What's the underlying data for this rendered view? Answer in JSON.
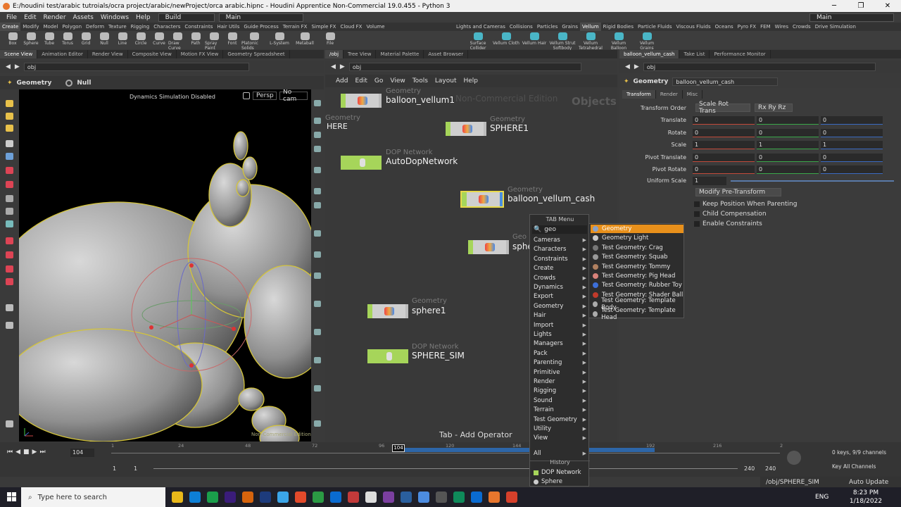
{
  "window": {
    "title": "E:/houdini test/arabic tutroials/ocra project/arabic/newProject/orca arabic.hipnc - Houdini Apprentice Non-Commercial 19.0.455 - Python 3",
    "controls": [
      "─",
      "❐",
      "✕"
    ]
  },
  "menubar": {
    "items": [
      "File",
      "Edit",
      "Render",
      "Assets",
      "Windows",
      "Help"
    ],
    "desktop_build": "Build",
    "desktop_main": "Main",
    "desktop_right": "Main"
  },
  "shelf": {
    "tabs_left": [
      "Create",
      "Modify",
      "Model",
      "Polygon",
      "Deform",
      "Texture",
      "Rigging",
      "Characters",
      "Constraints",
      "Hair Utils",
      "Guide Process",
      "Terrain FX",
      "Simple FX",
      "Cloud FX",
      "Volume"
    ],
    "tabs_right": [
      "Lights and Cameras",
      "Collisions",
      "Particles",
      "Grains",
      "Vellum",
      "Rigid Bodies",
      "Particle Fluids",
      "Viscous Fluids",
      "Oceans",
      "Pyro FX",
      "FEM",
      "Wires",
      "Crowds",
      "Drive Simulation"
    ],
    "tools_left": [
      "Box",
      "Sphere",
      "Tube",
      "Torus",
      "Grid",
      "Null",
      "Line",
      "Circle",
      "Curve",
      "Draw Curve",
      "Path",
      "Spray Paint",
      "Font",
      "Platonic Solids",
      "L-System",
      "Metaball",
      "File"
    ],
    "tools_right": [
      "Surface Collider",
      "Vellum Cloth",
      "Vellum Hair",
      "Vellum Strut Softbody",
      "Vellum Tetrahedral",
      "Vellum Balloon",
      "Vellum Grains"
    ]
  },
  "viewer": {
    "tabs": [
      "Scene View",
      "Animation Editor",
      "Render View",
      "Composite View",
      "Motion FX View",
      "Geometry Spreadsheet"
    ],
    "path": "obj",
    "context": "Geometry",
    "null_label": "Null",
    "status": "Dynamics Simulation Disabled",
    "persp": "Persp",
    "cam": "No cam",
    "watermark": "Non-Commercial Edition"
  },
  "network": {
    "tabs": [
      "/obj",
      "Tree View",
      "Material Palette",
      "Asset Browser"
    ],
    "path": "obj",
    "menus": [
      "Add",
      "Edit",
      "Go",
      "View",
      "Tools",
      "Layout",
      "Help"
    ],
    "watermark": "Non-Commercial Edition",
    "context_label": "Objects",
    "hint": "Tab - Add Operator",
    "nodes": [
      {
        "type": "Geometry",
        "name": "balloon_vellum1"
      },
      {
        "type": "Geometry",
        "name": "HERE"
      },
      {
        "type": "Geometry",
        "name": "SPHERE1"
      },
      {
        "type": "DOP Network",
        "name": "AutoDopNetwork"
      },
      {
        "type": "Geometry",
        "name": "balloon_vellum_cash"
      },
      {
        "type": "Geo",
        "name": "sphe"
      },
      {
        "type": "Geometry",
        "name": "sphere1"
      },
      {
        "type": "DOP Network",
        "name": "SPHERE_SIM"
      }
    ]
  },
  "tab_menu": {
    "title": "TAB Menu",
    "search": "geo",
    "items": [
      "Cameras",
      "Characters",
      "Constraints",
      "Create",
      "Crowds",
      "Dynamics",
      "Export",
      "Geometry",
      "Hair",
      "Import",
      "Lights",
      "Managers",
      "Pack",
      "Parenting",
      "Primitive",
      "Render",
      "Rigging",
      "Sound",
      "Terrain",
      "Test Geometry",
      "Utility",
      "View"
    ],
    "all": "All",
    "history_label": "History",
    "history": [
      "DOP Network",
      "Sphere"
    ],
    "arrow": "▶"
  },
  "submenu": {
    "items": [
      {
        "label": "Geometry",
        "icon": "#8aa2c8",
        "selected": true
      },
      {
        "label": "Geometry Light",
        "icon": "#c9c9c9",
        "selected": false
      },
      {
        "label": "Test Geometry: Crag",
        "icon": "#777",
        "selected": false
      },
      {
        "label": "Test Geometry: Squab",
        "icon": "#999",
        "selected": false
      },
      {
        "label": "Test Geometry: Tommy",
        "icon": "#b08060",
        "selected": false
      },
      {
        "label": "Test Geometry: Pig Head",
        "icon": "#d9827a",
        "selected": false
      },
      {
        "label": "Test Geometry: Rubber Toy",
        "icon": "#3d6fd9",
        "selected": false
      },
      {
        "label": "Test Geometry: Shader Ball",
        "icon": "#c03a2b",
        "selected": false
      },
      {
        "label": "Test Geometry: Template Body",
        "icon": "#aaa",
        "selected": false
      },
      {
        "label": "Test Geometry: Template Head",
        "icon": "#aaa",
        "selected": false
      }
    ]
  },
  "params": {
    "tabs": [
      "balloon_vellum_cash",
      "Take List",
      "Performance Monitor"
    ],
    "path": "obj",
    "node_type": "Geometry",
    "node_name": "balloon_vellum_cash",
    "subtabs": [
      "Transform",
      "Render",
      "Misc"
    ],
    "transform_order": {
      "label": "Transform Order",
      "value": "Scale Rot Trans",
      "rot": "Rx Ry Rz"
    },
    "rows": [
      {
        "label": "Translate",
        "v": [
          "0",
          "0",
          "0"
        ]
      },
      {
        "label": "Rotate",
        "v": [
          "0",
          "0",
          "0"
        ]
      },
      {
        "label": "Scale",
        "v": [
          "1",
          "1",
          "1"
        ]
      },
      {
        "label": "Pivot Translate",
        "v": [
          "0",
          "0",
          "0"
        ]
      },
      {
        "label": "Pivot Rotate",
        "v": [
          "0",
          "0",
          "0"
        ]
      }
    ],
    "uniform_scale": {
      "label": "Uniform Scale",
      "value": "1"
    },
    "modify": "Modify Pre-Transform",
    "checks": [
      "Keep Position When Parenting",
      "Child Compensation",
      "Enable Constraints"
    ]
  },
  "timeline": {
    "frame": "104",
    "current": "104",
    "ticks": [
      "1",
      "24",
      "48",
      "72",
      "96",
      "120",
      "144",
      "168",
      "192",
      "216",
      "2"
    ],
    "range_start": "1",
    "range_start2": "1",
    "range_end": "240",
    "range_end2": "240",
    "keys": "0 keys, 9/9 channels",
    "key_all": "Key All Channels",
    "sim_path": "/obj/SPHERE_SIM",
    "auto_update": "Auto Update"
  },
  "taskbar": {
    "search": "Type here to search",
    "lang": "ENG",
    "time": "8:23 PM",
    "date": "1/18/2022",
    "icon_colors": [
      "#e8b71a",
      "#0d7fd6",
      "#1a9e4b",
      "#3a1c7a",
      "#d6640d",
      "#1d3b7c",
      "#3ba5e8",
      "#e34a2b",
      "#2b9a44",
      "#0a6bd1",
      "#c23a3a",
      "#ddd",
      "#7b3fa0",
      "#2a5f9e",
      "#4c8ce0",
      "#555",
      "#0f8a5a",
      "#0a6bd1",
      "#e8762d",
      "#d6402b"
    ]
  }
}
